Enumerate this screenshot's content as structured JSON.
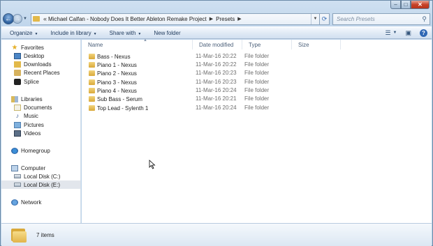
{
  "window": {
    "caption": {
      "minimize": "–",
      "maximize": "□",
      "close": "✕"
    }
  },
  "nav": {
    "back_glyph": "←",
    "forward_glyph": "→",
    "breadcrumb_overflow": "«",
    "breadcrumbs": [
      "Michael Calfan - Nobody Does It Better Ableton Remake Project",
      "Presets"
    ],
    "search_placeholder": "Search Presets"
  },
  "commands": [
    {
      "label": "Organize",
      "has_menu": true
    },
    {
      "label": "Include in library",
      "has_menu": true
    },
    {
      "label": "Share with",
      "has_menu": true
    },
    {
      "label": "New folder",
      "has_menu": false
    }
  ],
  "sidebar": {
    "favorites_label": "Favorites",
    "favorites": [
      "Desktop",
      "Downloads",
      "Recent Places",
      "Splice"
    ],
    "libraries_label": "Libraries",
    "libraries": [
      "Documents",
      "Music",
      "Pictures",
      "Videos"
    ],
    "homegroup_label": "Homegroup",
    "computer_label": "Computer",
    "drives": [
      "Local Disk (C:)",
      "Local Disk (E:)"
    ],
    "selected_drive": "Local Disk (E:)",
    "network_label": "Network"
  },
  "columns": [
    "Name",
    "Date modified",
    "Type",
    "Size"
  ],
  "files": [
    {
      "name": "Bass - Nexus",
      "date": "11-Mar-16 20:22",
      "type": "File folder"
    },
    {
      "name": "Piano 1 - Nexus",
      "date": "11-Mar-16 20:22",
      "type": "File folder"
    },
    {
      "name": "Piano 2 - Nexus",
      "date": "11-Mar-16 20:23",
      "type": "File folder"
    },
    {
      "name": "Piano 3 - Nexus",
      "date": "11-Mar-16 20:23",
      "type": "File folder"
    },
    {
      "name": "Piano 4 - Nexus",
      "date": "11-Mar-16 20:24",
      "type": "File folder"
    },
    {
      "name": "Sub Bass - Serum",
      "date": "11-Mar-16 20:21",
      "type": "File folder"
    },
    {
      "name": "Top Lead - Sylenth 1",
      "date": "11-Mar-16 20:24",
      "type": "File folder"
    }
  ],
  "details": {
    "item_count": "7 items"
  },
  "colors": {
    "window_frame": "#bed4ea",
    "content_bg": "#ffffff",
    "folder": "#e2b44a",
    "selection": "#e2e6ec"
  }
}
